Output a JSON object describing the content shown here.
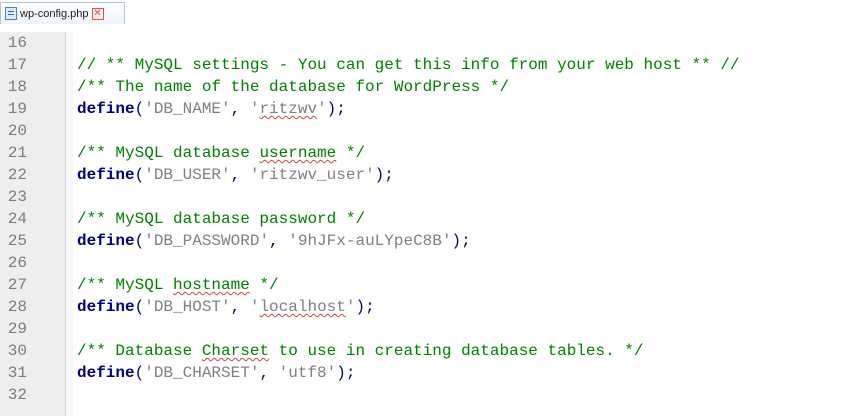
{
  "tab": {
    "title": "wp-config.php",
    "file_icon": "file-icon",
    "close_icon": "close-icon",
    "close_glyph": "✕"
  },
  "editor": {
    "lines": [
      {
        "number": "16",
        "tokens": []
      },
      {
        "number": "17",
        "tokens": [
          {
            "text": "// ** MySQL settings - You can get this info from your web host ** //",
            "type": "comment"
          }
        ]
      },
      {
        "number": "18",
        "tokens": [
          {
            "text": "/** The name of the database for WordPress */",
            "type": "comment"
          }
        ]
      },
      {
        "number": "19",
        "tokens": [
          {
            "text": "define",
            "type": "keyword"
          },
          {
            "text": "(",
            "type": "op"
          },
          {
            "text": "'DB_NAME'",
            "type": "string"
          },
          {
            "text": ", ",
            "type": "op"
          },
          {
            "text": "'",
            "type": "string"
          },
          {
            "text": "ritzwv",
            "type": "string",
            "spell": true
          },
          {
            "text": "'",
            "type": "string"
          },
          {
            "text": ");",
            "type": "op"
          }
        ]
      },
      {
        "number": "20",
        "tokens": []
      },
      {
        "number": "21",
        "tokens": [
          {
            "text": "/** MySQL database ",
            "type": "comment"
          },
          {
            "text": "username",
            "type": "comment",
            "spell": true
          },
          {
            "text": " */",
            "type": "comment"
          }
        ]
      },
      {
        "number": "22",
        "tokens": [
          {
            "text": "define",
            "type": "keyword"
          },
          {
            "text": "(",
            "type": "op"
          },
          {
            "text": "'DB_USER'",
            "type": "string"
          },
          {
            "text": ", ",
            "type": "op"
          },
          {
            "text": "'ritzwv_user'",
            "type": "string"
          },
          {
            "text": ");",
            "type": "op"
          }
        ]
      },
      {
        "number": "23",
        "tokens": []
      },
      {
        "number": "24",
        "tokens": [
          {
            "text": "/** MySQL database password */",
            "type": "comment"
          }
        ]
      },
      {
        "number": "25",
        "tokens": [
          {
            "text": "define",
            "type": "keyword"
          },
          {
            "text": "(",
            "type": "op"
          },
          {
            "text": "'DB_PASSWORD'",
            "type": "string"
          },
          {
            "text": ", ",
            "type": "op"
          },
          {
            "text": "'9hJFx-auLYpeC8B'",
            "type": "string"
          },
          {
            "text": ");",
            "type": "op"
          }
        ]
      },
      {
        "number": "26",
        "tokens": []
      },
      {
        "number": "27",
        "tokens": [
          {
            "text": "/** MySQL ",
            "type": "comment"
          },
          {
            "text": "hostname",
            "type": "comment",
            "spell": true
          },
          {
            "text": " */",
            "type": "comment"
          }
        ]
      },
      {
        "number": "28",
        "tokens": [
          {
            "text": "define",
            "type": "keyword"
          },
          {
            "text": "(",
            "type": "op"
          },
          {
            "text": "'DB_HOST'",
            "type": "string"
          },
          {
            "text": ", ",
            "type": "op"
          },
          {
            "text": "'",
            "type": "string"
          },
          {
            "text": "localhost",
            "type": "string",
            "spell": true
          },
          {
            "text": "'",
            "type": "string"
          },
          {
            "text": ");",
            "type": "op"
          }
        ]
      },
      {
        "number": "29",
        "tokens": []
      },
      {
        "number": "30",
        "tokens": [
          {
            "text": "/** Database ",
            "type": "comment"
          },
          {
            "text": "Charset",
            "type": "comment",
            "spell": true
          },
          {
            "text": " to use in creating database tables. */",
            "type": "comment"
          }
        ]
      },
      {
        "number": "31",
        "tokens": [
          {
            "text": "define",
            "type": "keyword"
          },
          {
            "text": "(",
            "type": "op"
          },
          {
            "text": "'DB_CHARSET'",
            "type": "string"
          },
          {
            "text": ", ",
            "type": "op"
          },
          {
            "text": "'utf8'",
            "type": "string"
          },
          {
            "text": ");",
            "type": "op"
          }
        ]
      },
      {
        "number": "32",
        "tokens": []
      }
    ]
  },
  "colors": {
    "comment": "#008000",
    "keyword": "#000080",
    "string": "#7f7f7f",
    "gutter_bg": "#eeeeee",
    "line_number": "#7d7d7d",
    "spellcheck_underline": "#d0443f"
  }
}
